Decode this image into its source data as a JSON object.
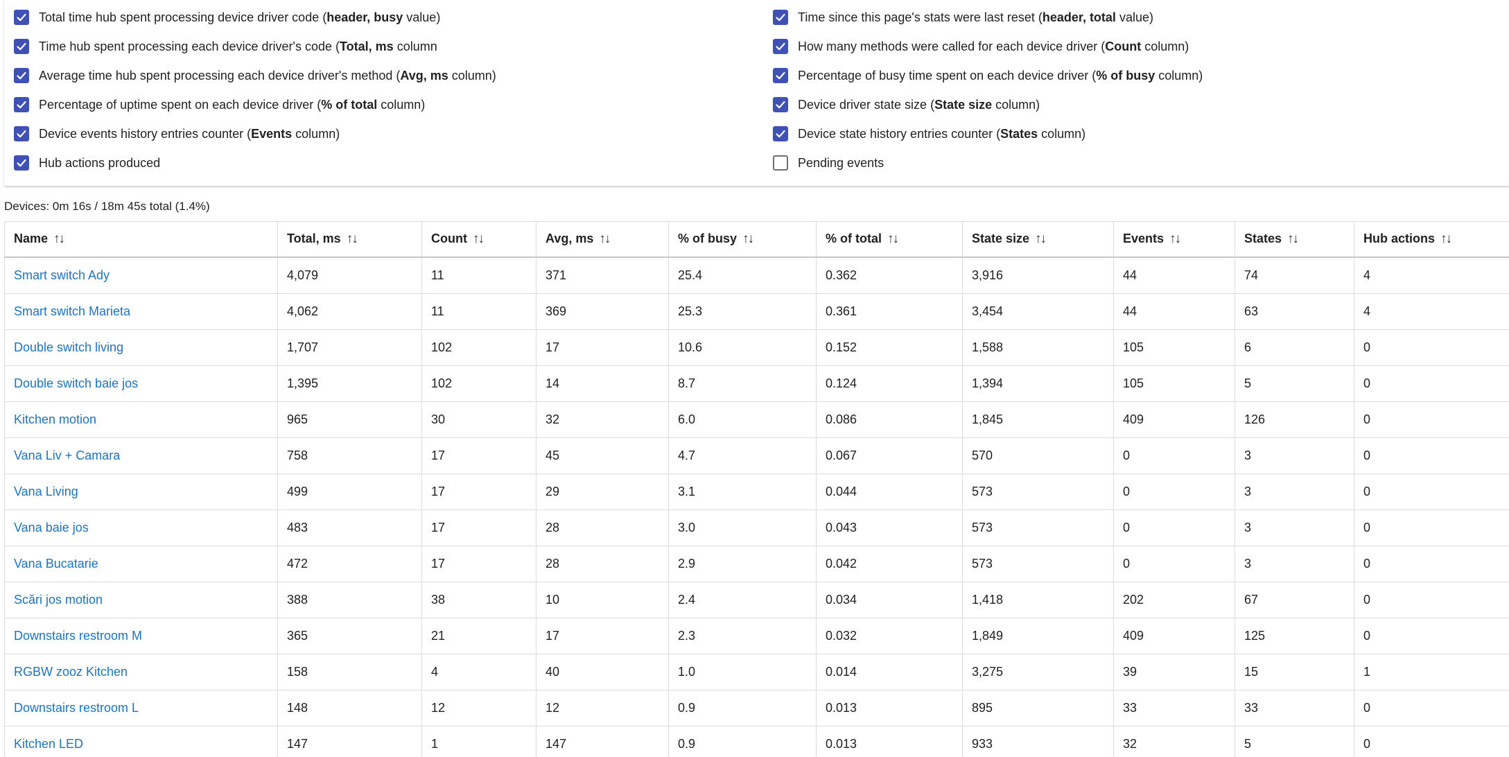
{
  "options": [
    {
      "pre": "Total time hub spent processing device driver code (",
      "bold": "header, busy",
      "post": " value)",
      "checked": true
    },
    {
      "pre": "Time since this page's stats were last reset (",
      "bold": "header, total",
      "post": " value)",
      "checked": true
    },
    {
      "pre": "Time hub spent processing each device driver's code (",
      "bold": "Total, ms",
      "post": " column",
      "checked": true
    },
    {
      "pre": "How many methods were called for each device driver (",
      "bold": "Count",
      "post": " column)",
      "checked": true
    },
    {
      "pre": "Average time hub spent processing each device driver's method (",
      "bold": "Avg, ms",
      "post": " column)",
      "checked": true
    },
    {
      "pre": "Percentage of busy time spent on each device driver (",
      "bold": "% of busy",
      "post": " column)",
      "checked": true
    },
    {
      "pre": "Percentage of uptime spent on each device driver (",
      "bold": "% of total",
      "post": " column)",
      "checked": true
    },
    {
      "pre": "Device driver state size (",
      "bold": "State size",
      "post": " column)",
      "checked": true
    },
    {
      "pre": "Device events history entries counter (",
      "bold": "Events",
      "post": " column)",
      "checked": true
    },
    {
      "pre": "Device state history entries counter (",
      "bold": "States",
      "post": " column)",
      "checked": true
    },
    {
      "pre": "Hub actions produced",
      "bold": "",
      "post": "",
      "checked": true
    },
    {
      "pre": "Pending events",
      "bold": "",
      "post": "",
      "checked": false
    }
  ],
  "summary": "Devices: 0m 16s / 18m 45s total (1.4%)",
  "sort_glyph": "↑↓",
  "columns": [
    "Name",
    "Total, ms",
    "Count",
    "Avg, ms",
    "% of busy",
    "% of total",
    "State size",
    "Events",
    "States",
    "Hub actions"
  ],
  "rows": [
    [
      "Smart switch Ady",
      "4,079",
      "11",
      "371",
      "25.4",
      "0.362",
      "3,916",
      "44",
      "74",
      "4"
    ],
    [
      "Smart switch Marieta",
      "4,062",
      "11",
      "369",
      "25.3",
      "0.361",
      "3,454",
      "44",
      "63",
      "4"
    ],
    [
      "Double switch living",
      "1,707",
      "102",
      "17",
      "10.6",
      "0.152",
      "1,588",
      "105",
      "6",
      "0"
    ],
    [
      "Double switch baie jos",
      "1,395",
      "102",
      "14",
      "8.7",
      "0.124",
      "1,394",
      "105",
      "5",
      "0"
    ],
    [
      "Kitchen motion",
      "965",
      "30",
      "32",
      "6.0",
      "0.086",
      "1,845",
      "409",
      "126",
      "0"
    ],
    [
      "Vana Liv + Camara",
      "758",
      "17",
      "45",
      "4.7",
      "0.067",
      "570",
      "0",
      "3",
      "0"
    ],
    [
      "Vana Living",
      "499",
      "17",
      "29",
      "3.1",
      "0.044",
      "573",
      "0",
      "3",
      "0"
    ],
    [
      "Vana baie jos",
      "483",
      "17",
      "28",
      "3.0",
      "0.043",
      "573",
      "0",
      "3",
      "0"
    ],
    [
      "Vana Bucatarie",
      "472",
      "17",
      "28",
      "2.9",
      "0.042",
      "573",
      "0",
      "3",
      "0"
    ],
    [
      "Scări jos motion",
      "388",
      "38",
      "10",
      "2.4",
      "0.034",
      "1,418",
      "202",
      "67",
      "0"
    ],
    [
      "Downstairs restroom M",
      "365",
      "21",
      "17",
      "2.3",
      "0.032",
      "1,849",
      "409",
      "125",
      "0"
    ],
    [
      "RGBW zooz Kitchen",
      "158",
      "4",
      "40",
      "1.0",
      "0.014",
      "3,275",
      "39",
      "15",
      "1"
    ],
    [
      "Downstairs restroom L",
      "148",
      "12",
      "12",
      "0.9",
      "0.013",
      "895",
      "33",
      "33",
      "0"
    ],
    [
      "Kitchen LED",
      "147",
      "1",
      "147",
      "0.9",
      "0.013",
      "933",
      "32",
      "5",
      "0"
    ]
  ],
  "colors": {
    "accent": "#3f51b5",
    "link": "#1e73be"
  }
}
